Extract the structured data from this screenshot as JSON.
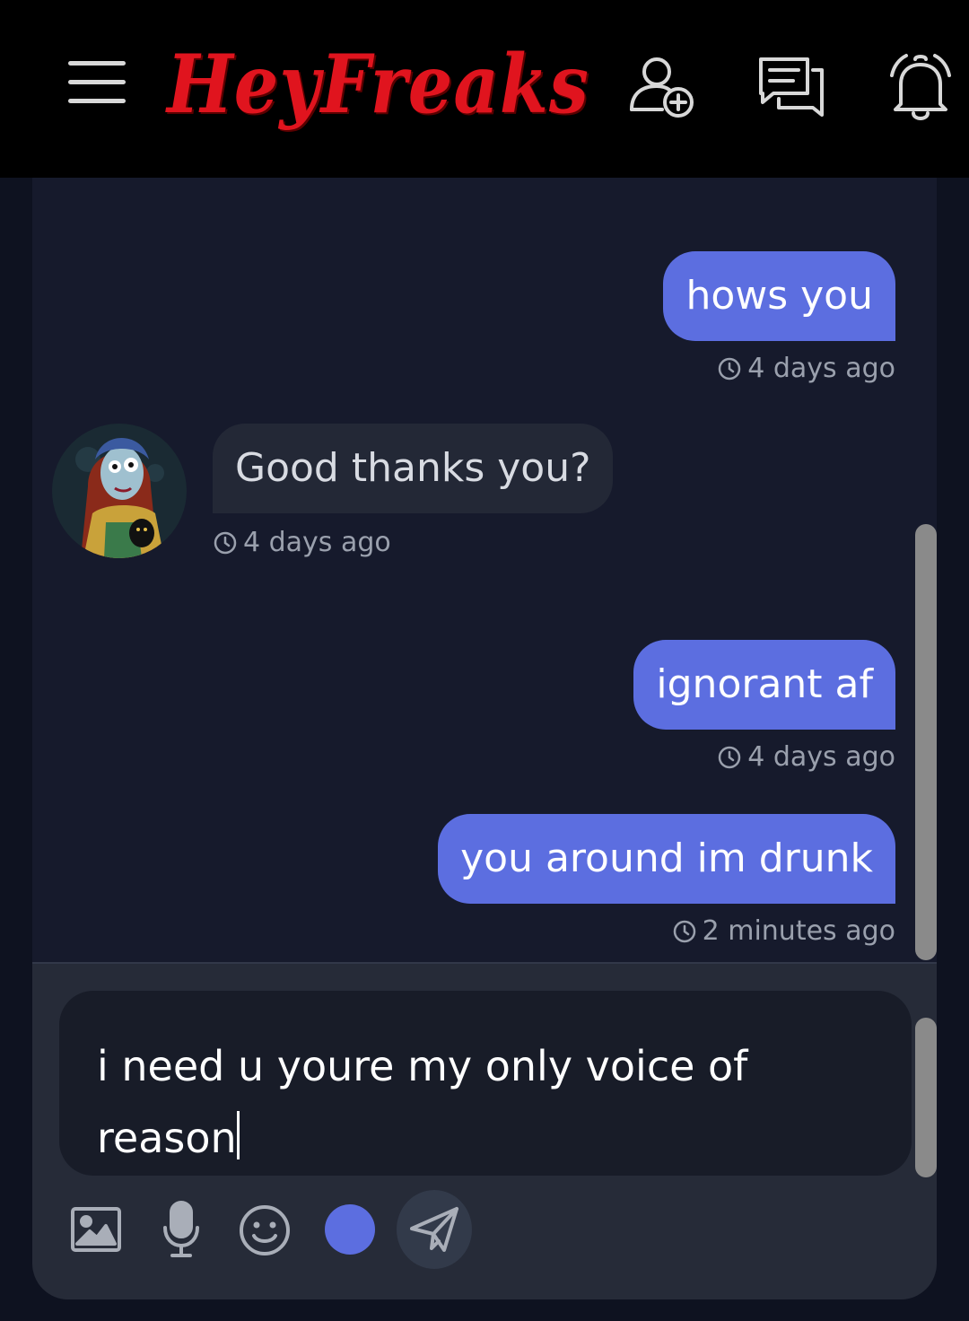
{
  "header": {
    "brand": "HeyFreaks",
    "menu_icon": "hamburger-menu-icon",
    "add_friend_icon": "user-plus-icon",
    "messages_icon": "chat-bubbles-icon",
    "notifications_icon": "bell-icon"
  },
  "messages": [
    {
      "direction": "outgoing",
      "text": "hows you",
      "time": "4 days ago"
    },
    {
      "direction": "incoming",
      "text": "Good thanks you?",
      "time": "4 days ago"
    },
    {
      "direction": "outgoing",
      "text": "ignorant af",
      "time": "4 days ago"
    },
    {
      "direction": "outgoing",
      "text": "you around im drunk",
      "time": "2 minutes ago"
    }
  ],
  "composer": {
    "draft_text": "i need u youre my only voice of reason",
    "tools": [
      "image-icon",
      "microphone-icon",
      "emoji-icon",
      "color-picker",
      "send-icon"
    ]
  },
  "colors": {
    "accent": "#5c6ee0",
    "brand_red": "#e0141e",
    "outgoing_bubble": "#5c6ee0",
    "incoming_bubble": "#232836",
    "chat_background": "#161a2c",
    "header_background": "#000000",
    "color_dot": "#5c6ee0"
  }
}
